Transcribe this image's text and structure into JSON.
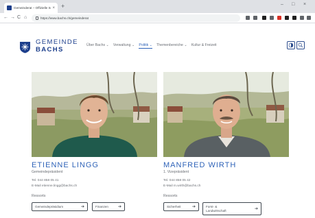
{
  "browser": {
    "tab_title": "Gemeinderat – Offizielle Seite de",
    "tab_close": "×",
    "new_tab": "+",
    "window_controls": [
      "–",
      "□",
      "×"
    ],
    "nav": [
      "←",
      "→",
      "C",
      "⌂"
    ],
    "url": "https://www.bachs.ch/gemeinderat",
    "extension_colors": [
      "#5f6368",
      "#5f6368",
      "#1f1f1f",
      "#5f6368",
      "#d93025",
      "#1f1f1f",
      "#1f1f1f",
      "#5f6368",
      "#5f6368"
    ]
  },
  "site": {
    "logo": {
      "line1": "GEMEINDE",
      "line2": "BACHS",
      "colors": {
        "primary": "#1d3f8c",
        "accent": "#2f63b8"
      }
    },
    "nav": [
      {
        "label": "Über Bachs ⌄",
        "active": false
      },
      {
        "label": "Verwaltung ⌄",
        "active": false
      },
      {
        "label": "Politik ⌄",
        "active": true
      },
      {
        "label": "Themenbereiche ⌄",
        "active": false
      },
      {
        "label": "Kultur & Freizeit",
        "active": false
      }
    ],
    "header_icons": [
      "accessibility-icon",
      "search-icon"
    ]
  },
  "people": [
    {
      "name": "ETIENNE LINGG",
      "role": "Gemeindepräsident",
      "phone": "Tel. 044 858 05 41",
      "email": "E-Mail etienne.lingg@bachs.ch",
      "resp_title": "Ressorts",
      "responsibilities": [
        {
          "label": "Gemeindepräsidium"
        },
        {
          "label": "Finanzen"
        }
      ]
    },
    {
      "name": "MANFRED WIRTH",
      "role": "1. Vizepräsident",
      "phone": "Tel. 044 858 05 42",
      "email": "E-Mail m.wirth@bachs.ch",
      "resp_title": "Ressorts",
      "responsibilities": [
        {
          "label": "Sicherheit"
        },
        {
          "label": "Forst- & Landwirtschaft"
        }
      ]
    }
  ]
}
